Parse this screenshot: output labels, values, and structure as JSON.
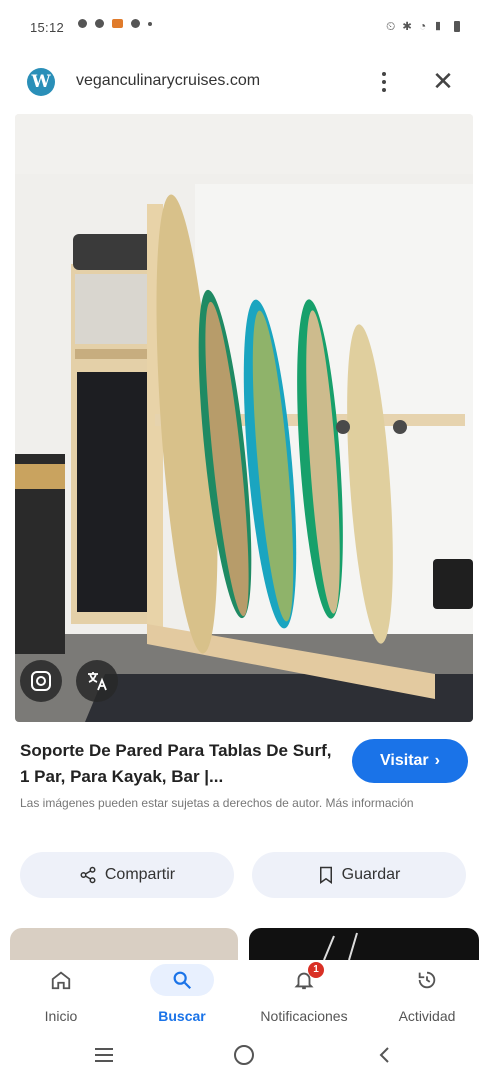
{
  "status_bar": {
    "time": "15:12",
    "right_icons_text": "⏲ ✱ ◔ ▮"
  },
  "browser": {
    "site_domain": "veganculinarycruises.com",
    "logo_letter": "W",
    "menu_icon": "more-vert-icon",
    "close_icon": "close-icon"
  },
  "result": {
    "title": "Soporte De Pared Para Tablas De Surf, 1 Par, Para Kayak, Bar |...",
    "visit_label": "Visitar",
    "disclaimer": "Las imágenes pueden estar sujetas a derechos de autor. Más información"
  },
  "actions": {
    "share_label": "Compartir",
    "save_label": "Guardar"
  },
  "bottom_nav": {
    "items": [
      {
        "label": "Inicio",
        "icon": "home-icon"
      },
      {
        "label": "Buscar",
        "icon": "search-icon",
        "active": true
      },
      {
        "label": "Notificaciones",
        "icon": "bell-icon",
        "badge": "1"
      },
      {
        "label": "Actividad",
        "icon": "history-icon"
      }
    ]
  },
  "colors": {
    "accent": "#1a73e8",
    "badge": "#d93025",
    "chip_bg": "#eef1f9"
  }
}
